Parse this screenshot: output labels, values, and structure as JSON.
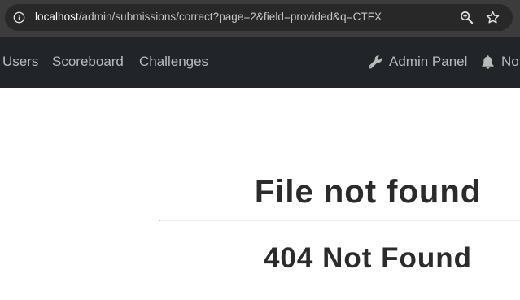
{
  "browser": {
    "url_host": "localhost",
    "url_path": "/admin/submissions/correct?page=2&field=provided&q=CTFX",
    "icons": [
      "info-icon",
      "zoom-icon",
      "star-icon"
    ]
  },
  "navbar": {
    "items": [
      {
        "label": "Users"
      },
      {
        "label": "Scoreboard"
      },
      {
        "label": "Challenges"
      }
    ],
    "admin_panel": {
      "label": "Admin Panel",
      "icon": "wrench-icon"
    },
    "notifications": {
      "label": "Notifications",
      "icon": "bell-icon"
    }
  },
  "main": {
    "title": "File not found",
    "subtitle": "404 Not Found"
  },
  "colors": {
    "chrome": "#3c3c3c",
    "omnibox": "#282828",
    "navbar": "#212529",
    "nav_text": "#b8babb",
    "page_text": "#2b2b2b"
  }
}
